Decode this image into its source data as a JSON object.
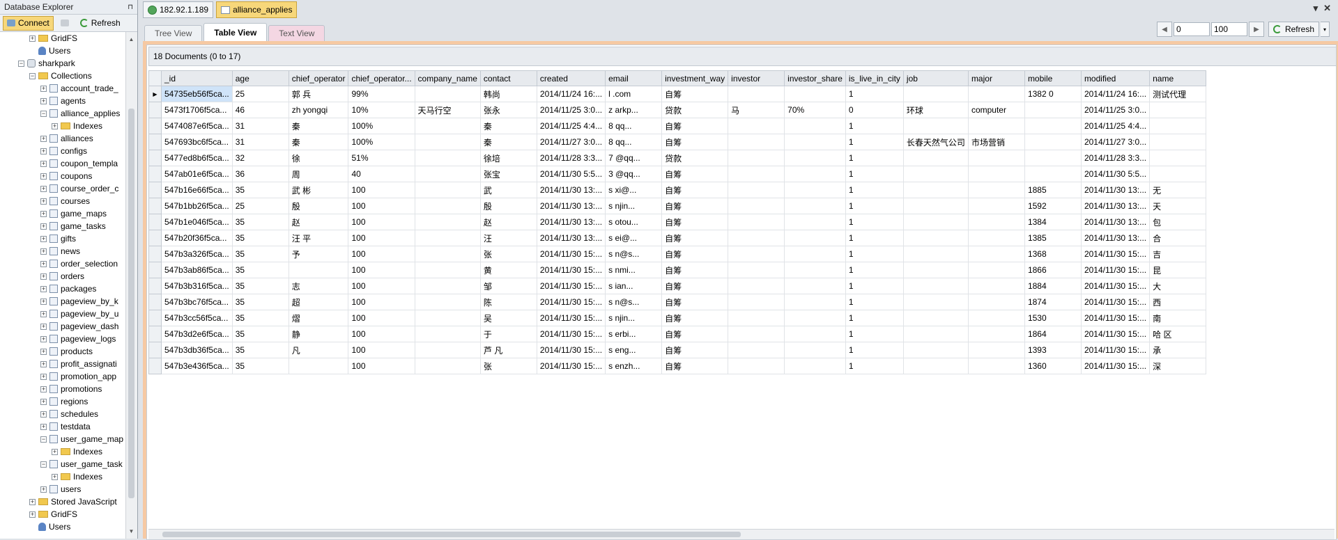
{
  "explorer": {
    "title": "Database Explorer",
    "pin_glyph": "⊓",
    "close_glyph": "✕",
    "connect_label": "Connect",
    "refresh_label": "Refresh",
    "tree": [
      {
        "label": "GridFS",
        "icon": "folder",
        "level": 2,
        "exp": "+"
      },
      {
        "label": "Users",
        "icon": "user",
        "level": 2,
        "exp": ""
      },
      {
        "label": "sharkpark",
        "icon": "db",
        "level": 1,
        "exp": "−"
      },
      {
        "label": "Collections",
        "icon": "folder",
        "level": 2,
        "exp": "−"
      },
      {
        "label": "account_trade_",
        "icon": "coll",
        "level": 3,
        "exp": "+"
      },
      {
        "label": "agents",
        "icon": "coll",
        "level": 3,
        "exp": "+"
      },
      {
        "label": "alliance_applies",
        "icon": "coll",
        "level": 3,
        "exp": "−"
      },
      {
        "label": "Indexes",
        "icon": "folder",
        "level": 4,
        "exp": "+"
      },
      {
        "label": "alliances",
        "icon": "coll",
        "level": 3,
        "exp": "+"
      },
      {
        "label": "configs",
        "icon": "coll",
        "level": 3,
        "exp": "+"
      },
      {
        "label": "coupon_templa",
        "icon": "coll",
        "level": 3,
        "exp": "+"
      },
      {
        "label": "coupons",
        "icon": "coll",
        "level": 3,
        "exp": "+"
      },
      {
        "label": "course_order_c",
        "icon": "coll",
        "level": 3,
        "exp": "+"
      },
      {
        "label": "courses",
        "icon": "coll",
        "level": 3,
        "exp": "+"
      },
      {
        "label": "game_maps",
        "icon": "coll",
        "level": 3,
        "exp": "+"
      },
      {
        "label": "game_tasks",
        "icon": "coll",
        "level": 3,
        "exp": "+"
      },
      {
        "label": "gifts",
        "icon": "coll",
        "level": 3,
        "exp": "+"
      },
      {
        "label": "news",
        "icon": "coll",
        "level": 3,
        "exp": "+"
      },
      {
        "label": "order_selection",
        "icon": "coll",
        "level": 3,
        "exp": "+"
      },
      {
        "label": "orders",
        "icon": "coll",
        "level": 3,
        "exp": "+"
      },
      {
        "label": "packages",
        "icon": "coll",
        "level": 3,
        "exp": "+"
      },
      {
        "label": "pageview_by_k",
        "icon": "coll",
        "level": 3,
        "exp": "+"
      },
      {
        "label": "pageview_by_u",
        "icon": "coll",
        "level": 3,
        "exp": "+"
      },
      {
        "label": "pageview_dash",
        "icon": "coll",
        "level": 3,
        "exp": "+"
      },
      {
        "label": "pageview_logs",
        "icon": "coll",
        "level": 3,
        "exp": "+"
      },
      {
        "label": "products",
        "icon": "coll",
        "level": 3,
        "exp": "+"
      },
      {
        "label": "profit_assignati",
        "icon": "coll",
        "level": 3,
        "exp": "+"
      },
      {
        "label": "promotion_app",
        "icon": "coll",
        "level": 3,
        "exp": "+"
      },
      {
        "label": "promotions",
        "icon": "coll",
        "level": 3,
        "exp": "+"
      },
      {
        "label": "regions",
        "icon": "coll",
        "level": 3,
        "exp": "+"
      },
      {
        "label": "schedules",
        "icon": "coll",
        "level": 3,
        "exp": "+"
      },
      {
        "label": "testdata",
        "icon": "coll",
        "level": 3,
        "exp": "+"
      },
      {
        "label": "user_game_map",
        "icon": "coll",
        "level": 3,
        "exp": "−"
      },
      {
        "label": "Indexes",
        "icon": "folder",
        "level": 4,
        "exp": "+"
      },
      {
        "label": "user_game_task",
        "icon": "coll",
        "level": 3,
        "exp": "−"
      },
      {
        "label": "Indexes",
        "icon": "folder",
        "level": 4,
        "exp": "+"
      },
      {
        "label": "users",
        "icon": "coll",
        "level": 3,
        "exp": "+"
      },
      {
        "label": "Stored JavaScript",
        "icon": "folder",
        "level": 2,
        "exp": "+"
      },
      {
        "label": "GridFS",
        "icon": "folder",
        "level": 2,
        "exp": "+"
      },
      {
        "label": "Users",
        "icon": "user",
        "level": 2,
        "exp": ""
      }
    ]
  },
  "topbar": {
    "server_tab": "182.92.1.189",
    "collection_tab": "alliance_applies",
    "window_controls": [
      "▾",
      "✕"
    ]
  },
  "view_tabs": [
    "Tree View",
    "Table View",
    "Text View"
  ],
  "active_view": "Table View",
  "paging": {
    "skip": "0",
    "limit": "100",
    "refresh_label": "Refresh"
  },
  "doc_count": "18 Documents (0 to 17)",
  "grid": {
    "columns": [
      "_id",
      "age",
      "chief_operator",
      "chief_operator...",
      "company_name",
      "contact",
      "created",
      "email",
      "investment_way",
      "investor",
      "investor_share",
      "is_live_in_city",
      "job",
      "major",
      "mobile",
      "modified",
      "name"
    ],
    "rows": [
      [
        "54735eb56f5ca...",
        "25",
        "郭 兵",
        "99%",
        "",
        "韩尚",
        "2014/11/24 16:...",
        "l        .com",
        "自筹",
        "",
        "",
        "1",
        "",
        "",
        "1382        0",
        "2014/11/24 16:...",
        "测试代理"
      ],
      [
        "5473f1706f5ca...",
        "46",
        "zh    yongqi",
        "10%",
        "天马行空",
        "张永",
        "2014/11/25 3:0...",
        "z        arkp...",
        "贷款",
        "马",
        "70%",
        "0",
        "环球",
        "computer",
        "",
        "2014/11/25 3:0...",
        ""
      ],
      [
        "5474087e6f5ca...",
        "31",
        "秦",
        "100%",
        "",
        "秦",
        "2014/11/25 4:4...",
        "8        qq...",
        "自筹",
        "",
        "",
        "1",
        "",
        "",
        "",
        "2014/11/25 4:4...",
        ""
      ],
      [
        "547693bc6f5ca...",
        "31",
        "秦",
        "100%",
        "",
        "秦",
        "2014/11/27 3:0...",
        "8        qq...",
        "自筹",
        "",
        "",
        "1",
        "长春天然气公司",
        "市场营销",
        "",
        "2014/11/27 3:0...",
        ""
      ],
      [
        "5477ed8b6f5ca...",
        "32",
        "徐",
        "51%",
        "",
        "徐培",
        "2014/11/28 3:3...",
        "7        @qq...",
        "贷款",
        "",
        "",
        "1",
        "",
        "",
        "",
        "2014/11/28 3:3...",
        ""
      ],
      [
        "547ab01e6f5ca...",
        "36",
        "周",
        "40",
        "",
        "张宝",
        "2014/11/30 5:5...",
        "3        @qq...",
        "自筹",
        "",
        "",
        "1",
        "",
        "",
        "",
        "2014/11/30 5:5...",
        ""
      ],
      [
        "547b16e66f5ca...",
        "35",
        "武  彬",
        "100",
        "",
        "武",
        "2014/11/30 13:...",
        "s        xi@...",
        "自筹",
        "",
        "",
        "1",
        "",
        "",
        "1885",
        "2014/11/30 13:...",
        "无"
      ],
      [
        "547b1bb26f5ca...",
        "25",
        "殷",
        "100",
        "",
        "殷",
        "2014/11/30 13:...",
        "s        njin...",
        "自筹",
        "",
        "",
        "1",
        "",
        "",
        "1592",
        "2014/11/30 13:...",
        "天"
      ],
      [
        "547b1e046f5ca...",
        "35",
        "赵",
        "100",
        "",
        "赵",
        "2014/11/30 13:...",
        "s        otou...",
        "自筹",
        "",
        "",
        "1",
        "",
        "",
        "1384",
        "2014/11/30 13:...",
        "包"
      ],
      [
        "547b20f36f5ca...",
        "35",
        "汪  平",
        "100",
        "",
        "汪",
        "2014/11/30 13:...",
        "s        ei@...",
        "自筹",
        "",
        "",
        "1",
        "",
        "",
        "1385",
        "2014/11/30 13:...",
        "合"
      ],
      [
        "547b3a326f5ca...",
        "35",
        "   予",
        "100",
        "",
        "张",
        "2014/11/30 15:...",
        "s        n@s...",
        "自筹",
        "",
        "",
        "1",
        "",
        "",
        "1368",
        "2014/11/30 15:...",
        "吉"
      ],
      [
        "547b3ab86f5ca...",
        "35",
        "",
        "100",
        "",
        "黄",
        "2014/11/30 15:...",
        "s        nmi...",
        "自筹",
        "",
        "",
        "1",
        "",
        "",
        "1866",
        "2014/11/30 15:...",
        "昆"
      ],
      [
        "547b3b316f5ca...",
        "35",
        "   志",
        "100",
        "",
        "邹",
        "2014/11/30 15:...",
        "s        ian...",
        "自筹",
        "",
        "",
        "1",
        "",
        "",
        "1884",
        "2014/11/30 15:...",
        "大"
      ],
      [
        "547b3bc76f5ca...",
        "35",
        "   超",
        "100",
        "",
        "陈",
        "2014/11/30 15:...",
        "s        n@s...",
        "自筹",
        "",
        "",
        "1",
        "",
        "",
        "1874",
        "2014/11/30 15:...",
        "西"
      ],
      [
        "547b3cc56f5ca...",
        "35",
        "   熠",
        "100",
        "",
        "吴",
        "2014/11/30 15:...",
        "s        njin...",
        "自筹",
        "",
        "",
        "1",
        "",
        "",
        "1530",
        "2014/11/30 15:...",
        "南"
      ],
      [
        "547b3d2e6f5ca...",
        "35",
        "   静",
        "100",
        "",
        "于",
        "2014/11/30 15:...",
        "s        erbi...",
        "自筹",
        "",
        "",
        "1",
        "",
        "",
        "1864",
        "2014/11/30 15:...",
        "哈     区"
      ],
      [
        "547b3db36f5ca...",
        "35",
        "   凡",
        "100",
        "",
        "芦  凡",
        "2014/11/30 15:...",
        "s        eng...",
        "自筹",
        "",
        "",
        "1",
        "",
        "",
        "1393",
        "2014/11/30 15:...",
        "承"
      ],
      [
        "547b3e436f5ca...",
        "35",
        "",
        "100",
        "",
        "张",
        "2014/11/30 15:...",
        "s        enzh...",
        "自筹",
        "",
        "",
        "1",
        "",
        "",
        "1360",
        "2014/11/30 15:...",
        "深"
      ]
    ]
  }
}
